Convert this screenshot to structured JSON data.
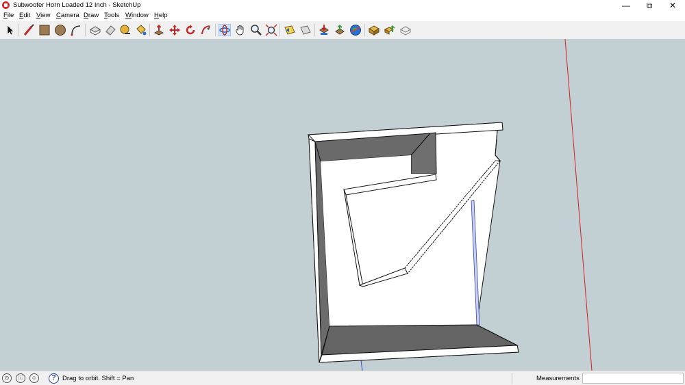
{
  "window": {
    "title": "Subwoofer Horn Loaded 12 Inch - SketchUp",
    "minimize_glyph": "—",
    "restore_glyph": "⧉",
    "close_glyph": "✕"
  },
  "menu": [
    "File",
    "Edit",
    "View",
    "Camera",
    "Draw",
    "Tools",
    "Window",
    "Help"
  ],
  "toolbar": {
    "tools": [
      "select-tool-icon",
      "line-tool-icon",
      "rectangle-tool-icon",
      "circle-tool-icon",
      "arc-tool-icon",
      "make-component-icon",
      "eraser-tool-icon",
      "tape-measure-icon",
      "paint-bucket-icon",
      "push-pull-icon",
      "move-tool-icon",
      "rotate-tool-icon",
      "follow-me-icon",
      "orbit-tool-icon",
      "pan-tool-icon",
      "zoom-tool-icon",
      "zoom-extents-icon",
      "previous-view-icon",
      "next-view-icon",
      "get-models-icon",
      "share-model-icon",
      "add-location-icon",
      "google-earth-icon",
      "extension-warehouse-icon",
      "share-component-icon",
      "components-icon"
    ]
  },
  "viewport": {
    "background": "#c2cfd3",
    "model_name": "Subwoofer Horn Loaded 12 Inch",
    "axis_colors": {
      "red": "#d21f1f",
      "blue": "#3548c8",
      "green": "#2fa52f"
    }
  },
  "status": {
    "icons": [
      "geo-location-icon",
      "credits-icon",
      "user-account-icon"
    ],
    "hint": "Drag to orbit.  Shift = Pan",
    "measurements_label": "Measurements",
    "measurements_value": ""
  }
}
